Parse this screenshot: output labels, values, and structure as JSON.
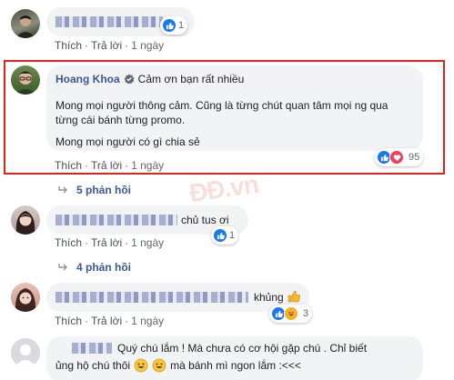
{
  "comment1": {
    "actions": [
      "Thích",
      "Trả lời",
      "1 ngày"
    ],
    "reaction_count": "1"
  },
  "comment2": {
    "author": "Hoang Khoa",
    "inline_text": "Cảm ơn bạn rất nhiều",
    "line1": "Mong mọi người thông cảm. Cũng là từng chút quan tâm mọi ng qua",
    "line2": "từng cái bánh từng promo.",
    "line3": "Mong mọi người có gì chia sẻ",
    "actions": [
      "Thích",
      "Trả lời",
      "1 ngày"
    ],
    "reaction_count": "95",
    "replies_label": "5 phản hồi"
  },
  "comment3": {
    "text_visible": "chủ tus ơi",
    "actions": [
      "Thích",
      "Trả lời",
      "1 ngày"
    ],
    "reaction_count": "1",
    "replies_label": "4 phản hồi"
  },
  "comment4": {
    "text_visible": "khủng",
    "actions": [
      "Thích",
      "Trả lời",
      "1 ngày"
    ],
    "reaction_count": "3"
  },
  "comment5": {
    "line1": "Quý chú lắm ! Mà chưa có cơ hội gặp chú . Chỉ biết",
    "line2a": "ủng hộ chú thôi",
    "line2b": "mà bánh mì ngon lắm :<<<"
  },
  "watermark": "ĐĐ.vn",
  "colors": {
    "link": "#385898",
    "like": "#1877f2",
    "love": "#f33e58",
    "haha": "#f7b125",
    "highlight": "#e0241b",
    "bubble": "#f2f3f5"
  },
  "icons": [
    "like-icon",
    "love-icon",
    "haha-icon",
    "verified-icon",
    "reply-arrow-icon",
    "heart-emoji",
    "thumbs-up-emoji",
    "grin-emoji"
  ]
}
